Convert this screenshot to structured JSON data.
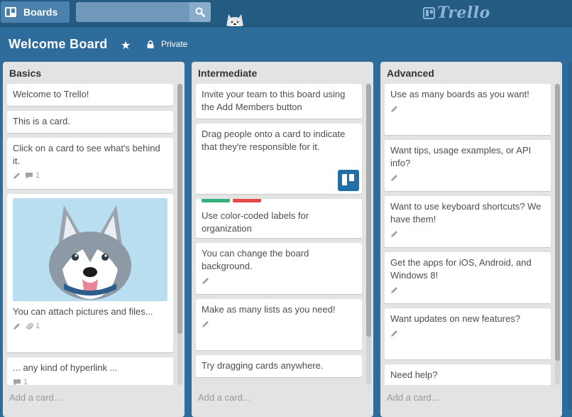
{
  "header": {
    "boards_label": "Boards",
    "search_placeholder": "",
    "logo_text": "Trello"
  },
  "board": {
    "title": "Welcome Board",
    "privacy": "Private"
  },
  "add_card_label": "Add a card...",
  "lists": [
    {
      "title": "Basics",
      "cards": [
        {
          "text": "Welcome to Trello!"
        },
        {
          "text": "This is a card."
        },
        {
          "text": "Click on a card to see what's behind it.",
          "comments": "1"
        },
        {
          "text": "You can attach pictures and files...",
          "attachments": "1"
        },
        {
          "text": "... any kind of hyperlink ...",
          "comments": "1"
        }
      ]
    },
    {
      "title": "Intermediate",
      "cards": [
        {
          "text": "Invite your team to this board using the Add Members button"
        },
        {
          "text": "Drag people onto a card to indicate that they're responsible for it."
        },
        {
          "text": "Use color-coded labels for organization"
        },
        {
          "text": "You can change the board background."
        },
        {
          "text": "Make as many lists as you need!"
        },
        {
          "text": "Try dragging cards anywhere."
        }
      ]
    },
    {
      "title": "Advanced",
      "cards": [
        {
          "text": "Use as many boards as you want!"
        },
        {
          "text": "Want tips, usage examples, or API info?"
        },
        {
          "text": "Want to use keyboard shortcuts? We have them!"
        },
        {
          "text": "Get the apps for iOS, Android, and Windows 8!"
        },
        {
          "text": "Want updates on new features?"
        },
        {
          "text": "Need help?"
        }
      ]
    }
  ],
  "colors": {
    "board_background": "#2e6c9b",
    "label_green": "#34b27d",
    "label_red": "#e24a4a",
    "card_image_background": "#b9def0"
  }
}
